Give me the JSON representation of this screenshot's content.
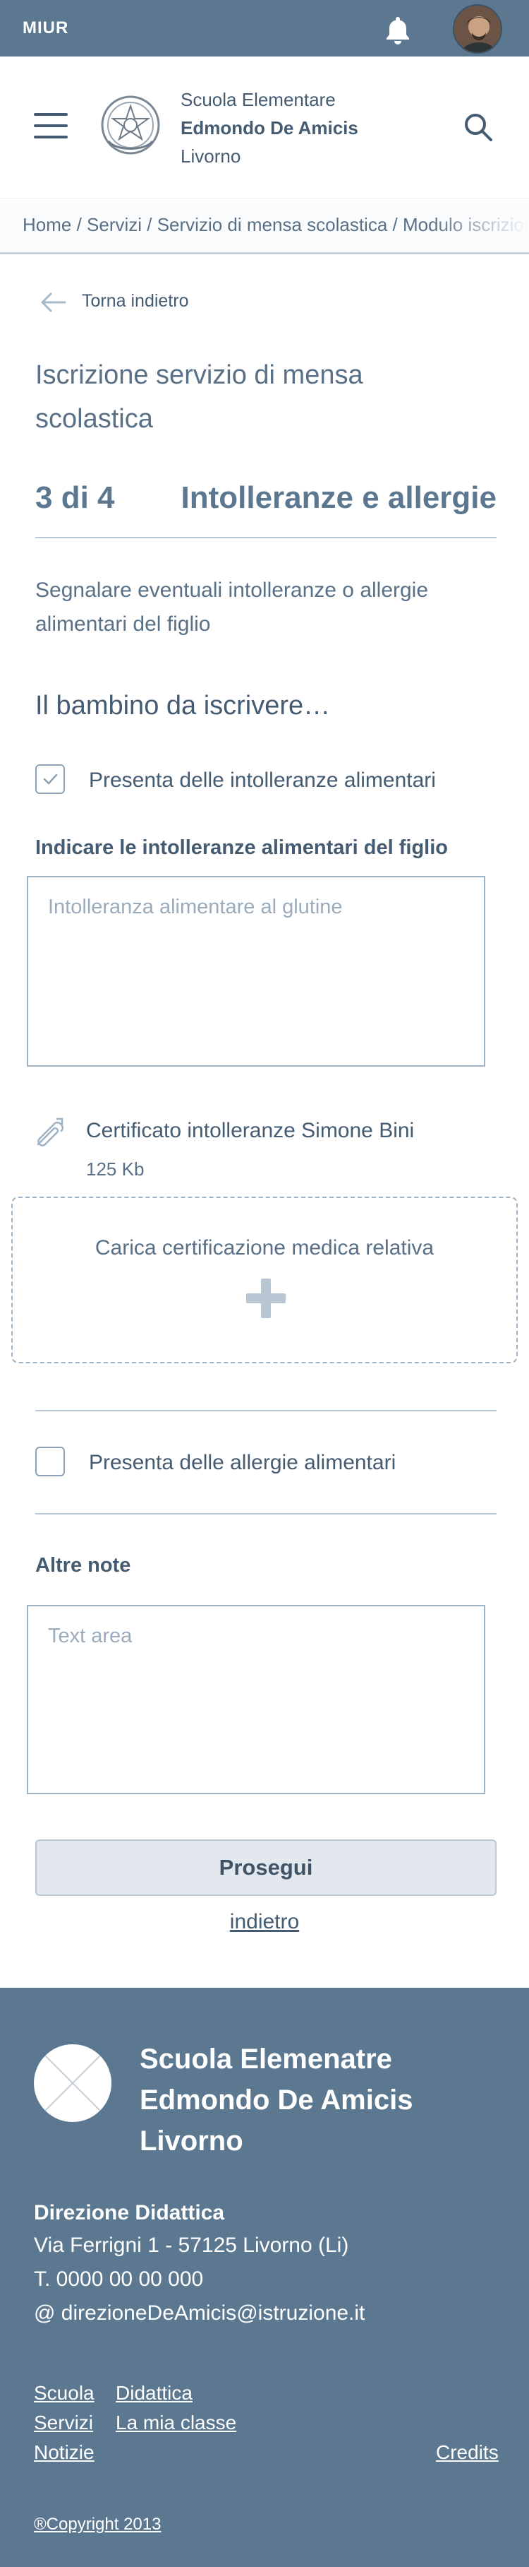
{
  "topbar": {
    "brand": "MIUR",
    "bell_icon": "bell-icon",
    "avatar": "user-avatar"
  },
  "header": {
    "menu_icon": "hamburger-menu-icon",
    "emblem_icon": "italian-republic-emblem",
    "school_line1": "Scuola Elementare",
    "school_line2": "Edmondo De Amicis",
    "school_line3": "Livorno",
    "search_icon": "search-icon"
  },
  "breadcrumb": {
    "text": "Home / Servizi / Servizio di mensa scolastica / Modulo iscrizione"
  },
  "back": {
    "label": "Torna indietro"
  },
  "page": {
    "title": "Iscrizione servizio di mensa scolastica",
    "step_number": "3 di 4",
    "step_name": "Intolleranze e allergie",
    "description": "Segnalare eventuali intolleranze o allergie alimentari del figlio",
    "section_heading": "Il bambino da iscrivere…"
  },
  "form": {
    "intolerance_checkbox_label": "Presenta delle intolleranze alimentari",
    "intolerance_checked": true,
    "intolerance_field_label": "Indicare le intolleranze alimentari del figlio",
    "intolerance_placeholder": "Intolleranza alimentare al glutine",
    "file_name": "Certificato intolleranze Simone Bini",
    "file_size": "125 Kb",
    "upload_label": "Carica certificazione medica relativa",
    "allergy_checkbox_label": "Presenta delle allergie alimentari",
    "allergy_checked": false,
    "notes_label": "Altre note",
    "notes_placeholder": "Text area",
    "submit_label": "Prosegui",
    "back_label": "indietro"
  },
  "footer": {
    "school_name": "Scuola Elemenatre Edmondo De Amicis Livorno",
    "direction_label": "Direzione Didattica",
    "address": "Via Ferrigni 1 - 57125 Livorno (Li)",
    "phone": "T. 0000 00 00 000",
    "email": "@ direzioneDeAmicis@istruzione.it",
    "links": [
      "Scuola",
      "Servizi",
      "Notizie",
      "Didattica",
      "La mia classe"
    ],
    "credits": "Credits",
    "copyright": "®Copyright 2013"
  },
  "colors": {
    "primary": "#5c7891",
    "text": "#455b71",
    "border": "#9fb3c5",
    "button_bg": "#e3e8ee"
  }
}
